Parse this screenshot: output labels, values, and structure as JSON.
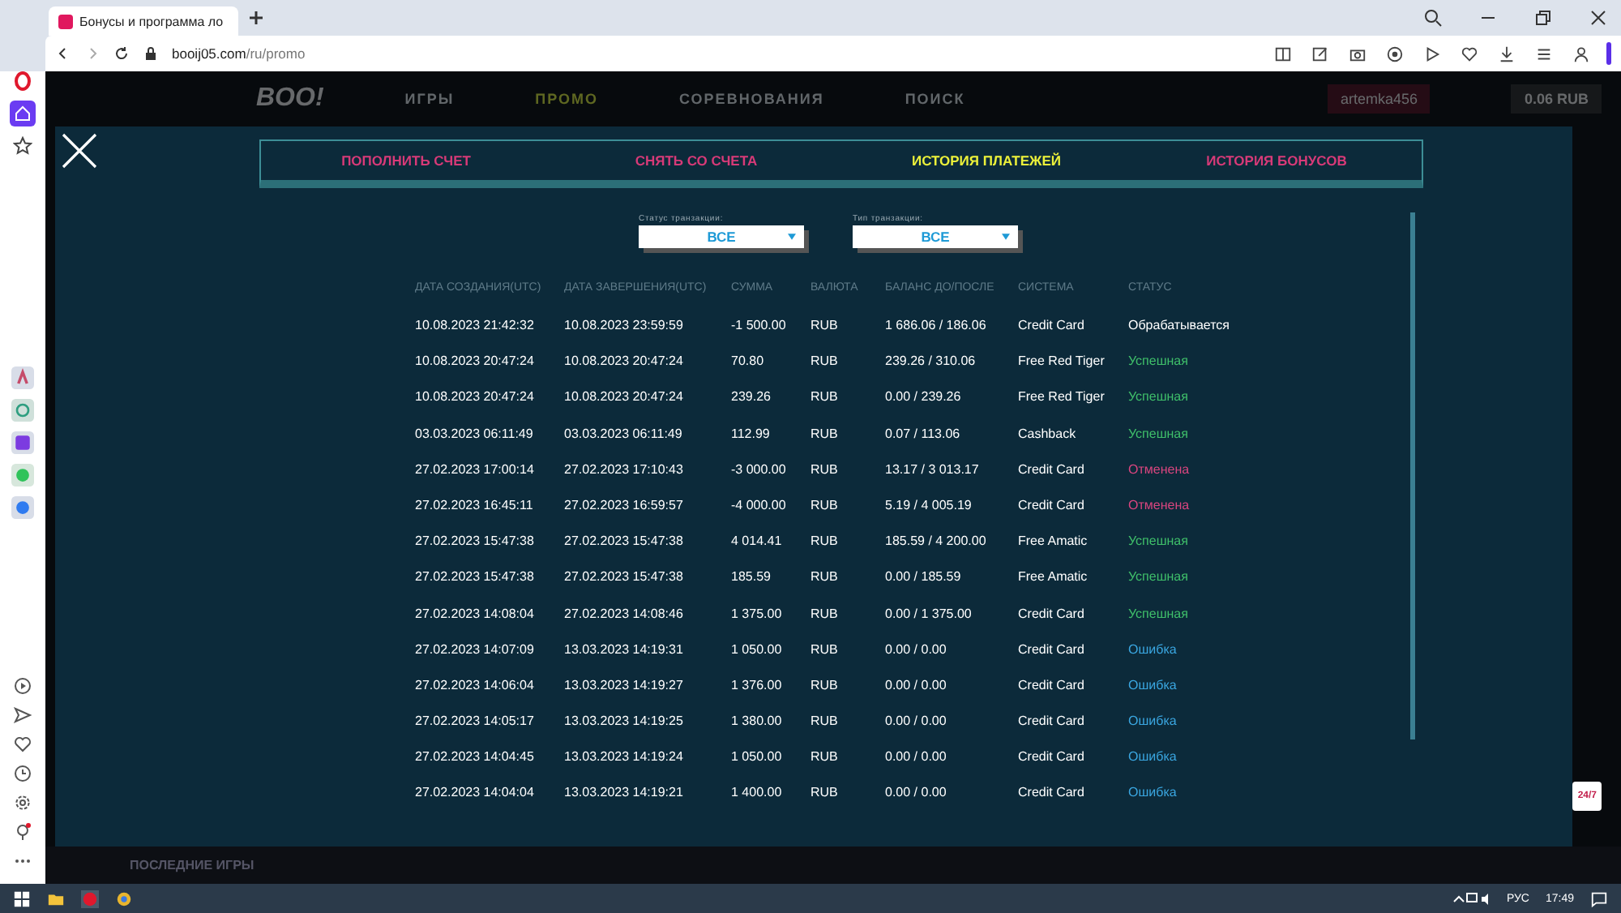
{
  "browser": {
    "tab_title": "Бонусы и программа ло",
    "url_host": "booij05.com",
    "url_path": "/ru/promo"
  },
  "site_nav": {
    "logo": "BOO!",
    "items": [
      "ИГРЫ",
      "ПРОМО",
      "СОРЕВНОВАНИЯ",
      "ПОИСК"
    ],
    "user": "artemka456",
    "balance": "0.06 RUB"
  },
  "tabs": [
    {
      "label": "ПОПОЛНИТЬ СЧЕТ",
      "selected": false
    },
    {
      "label": "СНЯТЬ СО СЧЕТА",
      "selected": false
    },
    {
      "label": "ИСТОРИЯ ПЛАТЕЖЕЙ",
      "selected": true
    },
    {
      "label": "ИСТОРИЯ БОНУСОВ",
      "selected": false
    }
  ],
  "filters": [
    {
      "label": "Статус транзакции:",
      "value": "ВСЕ"
    },
    {
      "label": "Тип транзакции:",
      "value": "ВСЕ"
    }
  ],
  "table": {
    "columns": [
      "ДАТА СОЗДАНИЯ(UTC)",
      "ДАТА ЗАВЕРШЕНИЯ(UTC)",
      "СУММА",
      "ВАЛЮТА",
      "БАЛАНС ДО/ПОСЛЕ",
      "СИСТЕМА",
      "СТАТУС"
    ],
    "rows": [
      {
        "cells": [
          "10.08.2023 21:42:32",
          "10.08.2023 23:59:59",
          "-1 500.00",
          "RUB",
          "1 686.06 / 186.06",
          "Credit Card"
        ],
        "status": "Обрабатывается",
        "kind": "processing"
      },
      {
        "cells": [
          "10.08.2023 20:47:24",
          "10.08.2023 20:47:24",
          "70.80",
          "RUB",
          "239.26 / 310.06",
          "Free Red Tiger"
        ],
        "status": "Успешная",
        "kind": "success"
      },
      {
        "cells": [
          "10.08.2023 20:47:24",
          "10.08.2023 20:47:24",
          "239.26",
          "RUB",
          "0.00 / 239.26",
          "Free Red Tiger"
        ],
        "status": "Успешная",
        "kind": "success"
      },
      {
        "cells": [
          "03.03.2023 06:11:49",
          "03.03.2023 06:11:49",
          "112.99",
          "RUB",
          "0.07 / 113.06",
          "Cashback"
        ],
        "status": "Успешная",
        "kind": "success"
      },
      {
        "cells": [
          "27.02.2023 17:00:14",
          "27.02.2023 17:10:43",
          "-3 000.00",
          "RUB",
          "13.17 / 3 013.17",
          "Credit Card"
        ],
        "status": "Отменена",
        "kind": "cancelled"
      },
      {
        "cells": [
          "27.02.2023 16:45:11",
          "27.02.2023 16:59:57",
          "-4 000.00",
          "RUB",
          "5.19 / 4 005.19",
          "Credit Card"
        ],
        "status": "Отменена",
        "kind": "cancelled"
      },
      {
        "cells": [
          "27.02.2023 15:47:38",
          "27.02.2023 15:47:38",
          "4 014.41",
          "RUB",
          "185.59 / 4 200.00",
          "Free Amatic"
        ],
        "status": "Успешная",
        "kind": "success"
      },
      {
        "cells": [
          "27.02.2023 15:47:38",
          "27.02.2023 15:47:38",
          "185.59",
          "RUB",
          "0.00 / 185.59",
          "Free Amatic"
        ],
        "status": "Успешная",
        "kind": "success"
      },
      {
        "cells": [
          "27.02.2023 14:08:04",
          "27.02.2023 14:08:46",
          "1 375.00",
          "RUB",
          "0.00 / 1 375.00",
          "Credit Card"
        ],
        "status": "Успешная",
        "kind": "success"
      },
      {
        "cells": [
          "27.02.2023 14:07:09",
          "13.03.2023 14:19:31",
          "1 050.00",
          "RUB",
          "0.00 / 0.00",
          "Credit Card"
        ],
        "status": "Ошибка",
        "kind": "error"
      },
      {
        "cells": [
          "27.02.2023 14:06:04",
          "13.03.2023 14:19:27",
          "1 376.00",
          "RUB",
          "0.00 / 0.00",
          "Credit Card"
        ],
        "status": "Ошибка",
        "kind": "error"
      },
      {
        "cells": [
          "27.02.2023 14:05:17",
          "13.03.2023 14:19:25",
          "1 380.00",
          "RUB",
          "0.00 / 0.00",
          "Credit Card"
        ],
        "status": "Ошибка",
        "kind": "error"
      },
      {
        "cells": [
          "27.02.2023 14:04:45",
          "13.03.2023 14:19:24",
          "1 050.00",
          "RUB",
          "0.00 / 0.00",
          "Credit Card"
        ],
        "status": "Ошибка",
        "kind": "error"
      },
      {
        "cells": [
          "27.02.2023 14:04:04",
          "13.03.2023 14:19:21",
          "1 400.00",
          "RUB",
          "0.00 / 0.00",
          "Credit Card"
        ],
        "status": "Ошибка",
        "kind": "error"
      }
    ]
  },
  "support_badge": "24/7",
  "bottom_bar": {
    "label": "ПОСЛЕДНИЕ ИГРЫ"
  },
  "taskbar": {
    "language": "РУС",
    "time": "17:49"
  }
}
